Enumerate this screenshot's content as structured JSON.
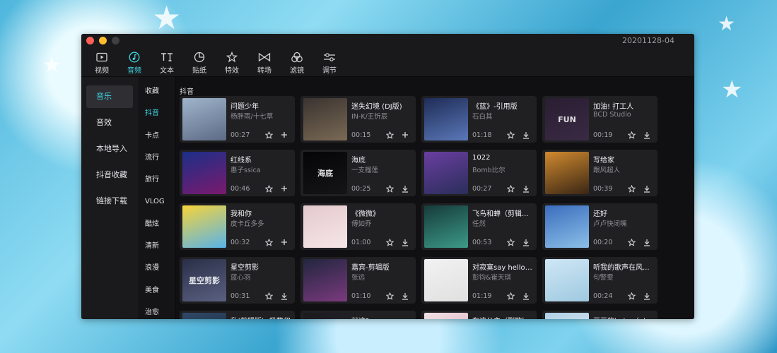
{
  "window": {
    "title": "20201128-04"
  },
  "toolbar": [
    {
      "label": "视频",
      "icon": "video-icon"
    },
    {
      "label": "音频",
      "icon": "music-note-icon",
      "active": true
    },
    {
      "label": "文本",
      "icon": "text-icon"
    },
    {
      "label": "贴纸",
      "icon": "sticker-icon"
    },
    {
      "label": "特效",
      "icon": "effects-star-icon"
    },
    {
      "label": "转场",
      "icon": "transition-icon"
    },
    {
      "label": "滤镜",
      "icon": "filter-icon"
    },
    {
      "label": "调节",
      "icon": "adjust-sliders-icon"
    }
  ],
  "left_nav": [
    {
      "label": "音乐",
      "active": true
    },
    {
      "label": "音效"
    },
    {
      "label": "本地导入"
    },
    {
      "label": "抖音收藏"
    },
    {
      "label": "链接下载"
    }
  ],
  "categories": [
    {
      "label": "收藏"
    },
    {
      "label": "抖音",
      "active": true
    },
    {
      "label": "卡点"
    },
    {
      "label": "流行"
    },
    {
      "label": "旅行"
    },
    {
      "label": "VLOG"
    },
    {
      "label": "酷炫"
    },
    {
      "label": "清新"
    },
    {
      "label": "浪漫"
    },
    {
      "label": "美食"
    },
    {
      "label": "治愈"
    }
  ],
  "section_title": "抖音",
  "cards": [
    {
      "title": "问题少年",
      "artist": "杨胖雨/十七草",
      "duration": "00:27",
      "action": "add",
      "thumb_text": "",
      "colors": [
        "#9fb5cc",
        "#5d6a85"
      ]
    },
    {
      "title": "迷失幻境 (DJ版)",
      "artist": "IN-K/王忻辰",
      "duration": "00:15",
      "action": "add",
      "thumb_text": "",
      "colors": [
        "#3a3330",
        "#7a6a55"
      ]
    },
    {
      "title": "《蓝》-引用版",
      "artist": "石白其",
      "duration": "01:18",
      "action": "download",
      "thumb_text": "",
      "colors": [
        "#1f2c57",
        "#5a78b8"
      ]
    },
    {
      "title": "加油! 打工人",
      "artist": "BCD Studio",
      "duration": "00:19",
      "action": "download",
      "thumb_text": "FUN",
      "colors": [
        "#2a1e32",
        "#3a2a44"
      ]
    },
    {
      "title": "红线系",
      "artist": "惠子ssica",
      "duration": "00:46",
      "action": "add",
      "thumb_text": "",
      "colors": [
        "#1c2f88",
        "#7a1a6e"
      ]
    },
    {
      "title": "海底",
      "artist": "一支榴莲",
      "duration": "00:25",
      "action": "download",
      "thumb_text": "海底",
      "colors": [
        "#050507",
        "#151518"
      ]
    },
    {
      "title": "1022",
      "artist": "Bomb比尔",
      "duration": "00:27",
      "action": "download",
      "thumb_text": "",
      "colors": [
        "#6a3ea0",
        "#2a2e5a"
      ]
    },
    {
      "title": "写给家",
      "artist": "跟风超人",
      "duration": "00:39",
      "action": "download",
      "thumb_text": "",
      "colors": [
        "#d08a2e",
        "#3a2615"
      ]
    },
    {
      "title": "我和你",
      "artist": "皮卡丘多多",
      "duration": "00:32",
      "action": "add",
      "thumb_text": "",
      "colors": [
        "#f6d43a",
        "#58b3ea"
      ]
    },
    {
      "title": "《微微》",
      "artist": "傅如乔",
      "duration": "01:00",
      "action": "download",
      "thumb_text": "",
      "colors": [
        "#e4c9cd",
        "#f6e6e8"
      ]
    },
    {
      "title": "飞鸟和蝉（剪辑...",
      "artist": "任然",
      "duration": "00:53",
      "action": "download",
      "thumb_text": "",
      "colors": [
        "#163a3a",
        "#3c9a88"
      ]
    },
    {
      "title": "还好",
      "artist": "卢卢快闭嘴",
      "duration": "00:20",
      "action": "download",
      "thumb_text": "",
      "colors": [
        "#3a6dbd",
        "#8cc0e8"
      ]
    },
    {
      "title": "星空剪影",
      "artist": "蓝心羽",
      "duration": "00:31",
      "action": "download",
      "thumb_text": "星空剪影",
      "colors": [
        "#2a2f48",
        "#5a6080"
      ]
    },
    {
      "title": "嘉宾-剪辑版",
      "artist": "张远",
      "duration": "01:10",
      "action": "download",
      "thumb_text": "",
      "colors": [
        "#22263f",
        "#7a3a7e"
      ]
    },
    {
      "title": "对寂寞say hello-...",
      "artist": "彭钧&崔天琪",
      "duration": "01:19",
      "action": "download",
      "thumb_text": "",
      "colors": [
        "#f2f2f2",
        "#e0e0e0"
      ]
    },
    {
      "title": "听我的歌声在风...",
      "artist": "句警雯",
      "duration": "00:24",
      "action": "download",
      "thumb_text": "",
      "colors": [
        "#cfe7f5",
        "#9ec9e0"
      ]
    },
    {
      "title": "乱(剪辑版)--杨馥伊",
      "artist": "",
      "duration": "",
      "action": "download",
      "thumb_text": "",
      "colors": [
        "#2f4866",
        "#1a2a40"
      ]
    },
    {
      "title": "就这?",
      "artist": "",
      "duration": "",
      "action": "download",
      "thumb_text": "",
      "colors": [
        "#1a1a1e",
        "#2b2b30"
      ]
    },
    {
      "title": "在逃公主（副歌）",
      "artist": "",
      "duration": "",
      "action": "download",
      "thumb_text": "",
      "colors": [
        "#f1e2e6",
        "#d99aa9"
      ]
    },
    {
      "title": "画画的baby（gla...",
      "artist": "",
      "duration": "",
      "action": "download",
      "thumb_text": "",
      "colors": [
        "#b0d0e8",
        "#f0f0f0"
      ]
    }
  ],
  "colors": {
    "accent": "#3ed3e2",
    "panel": "#1a1a1c",
    "card": "#202023"
  }
}
